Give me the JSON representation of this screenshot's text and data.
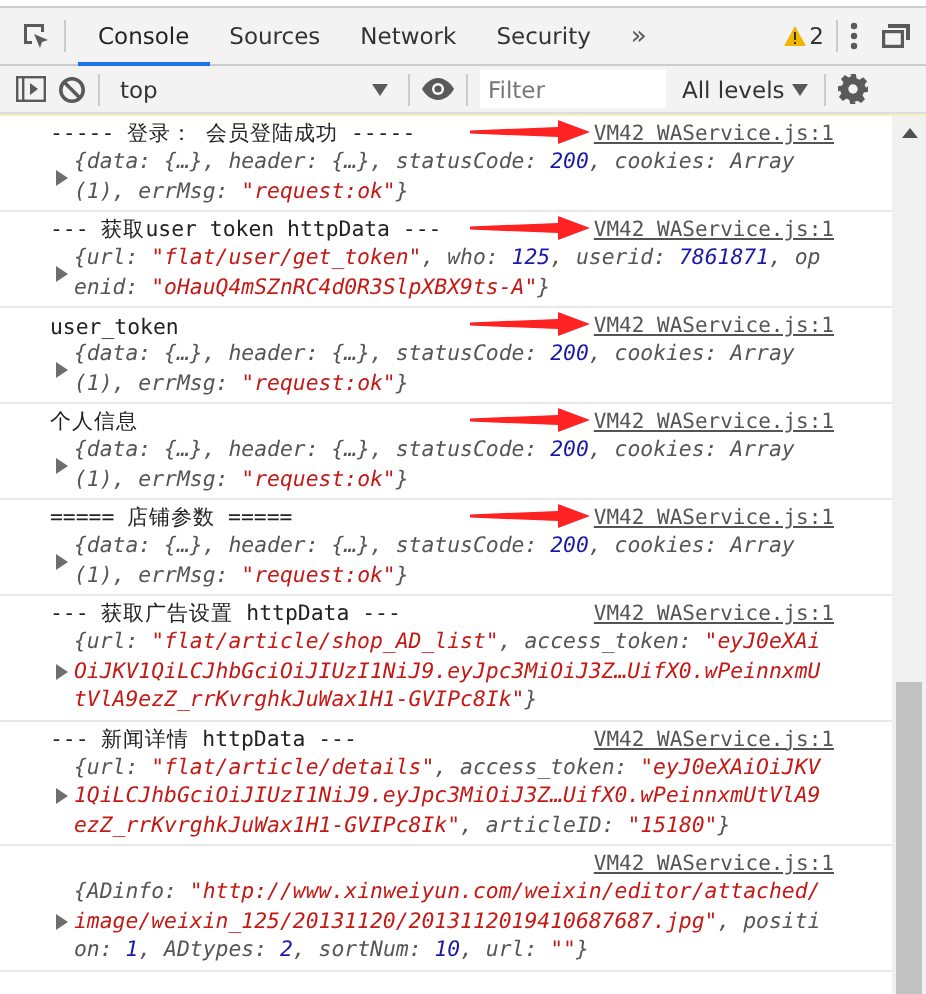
{
  "tabs": [
    {
      "label": "Console",
      "selected": true
    },
    {
      "label": "Sources",
      "selected": false
    },
    {
      "label": "Network",
      "selected": false
    },
    {
      "label": "Security",
      "selected": false
    }
  ],
  "more_tabs": "»",
  "warnings": "2",
  "toolbar": {
    "context": "top",
    "filter_placeholder": "Filter",
    "levels": "All levels"
  },
  "entries": [
    {
      "message": "----- 登录： 会员登陆成功 -----",
      "source": "VM42 WAService.js:1",
      "arrow": true,
      "object": [
        [
          {
            "kind": "text",
            "text": "{data: {…}, header: {…}, statusCode: "
          },
          {
            "kind": "number",
            "text": "200"
          },
          {
            "kind": "text",
            "text": ", cookies: Array"
          }
        ],
        [
          {
            "kind": "text",
            "text": "(1), errMsg: "
          },
          {
            "kind": "string",
            "text": "\"request:ok\""
          },
          {
            "kind": "text",
            "text": "}"
          }
        ]
      ]
    },
    {
      "message": "--- 获取user token httpData ---",
      "source": "VM42 WAService.js:1",
      "arrow": true,
      "object": [
        [
          {
            "kind": "text",
            "text": "{url: "
          },
          {
            "kind": "string",
            "text": "\"flat/user/get_token\""
          },
          {
            "kind": "text",
            "text": ", who: "
          },
          {
            "kind": "number",
            "text": "125"
          },
          {
            "kind": "text",
            "text": ", userid: "
          },
          {
            "kind": "number",
            "text": "7861871"
          },
          {
            "kind": "text",
            "text": ", op"
          }
        ],
        [
          {
            "kind": "text",
            "text": "enid: "
          },
          {
            "kind": "string",
            "text": "\"oHauQ4mSZnRC4d0R3SlpXBX9ts-A\""
          },
          {
            "kind": "text",
            "text": "}"
          }
        ]
      ]
    },
    {
      "message": "user_token",
      "source": "VM42 WAService.js:1",
      "arrow": true,
      "object": [
        [
          {
            "kind": "text",
            "text": "{data: {…}, header: {…}, statusCode: "
          },
          {
            "kind": "number",
            "text": "200"
          },
          {
            "kind": "text",
            "text": ", cookies: Array"
          }
        ],
        [
          {
            "kind": "text",
            "text": "(1), errMsg: "
          },
          {
            "kind": "string",
            "text": "\"request:ok\""
          },
          {
            "kind": "text",
            "text": "}"
          }
        ]
      ]
    },
    {
      "message": "个人信息",
      "source": "VM42 WAService.js:1",
      "arrow": true,
      "object": [
        [
          {
            "kind": "text",
            "text": "{data: {…}, header: {…}, statusCode: "
          },
          {
            "kind": "number",
            "text": "200"
          },
          {
            "kind": "text",
            "text": ", cookies: Array"
          }
        ],
        [
          {
            "kind": "text",
            "text": "(1), errMsg: "
          },
          {
            "kind": "string",
            "text": "\"request:ok\""
          },
          {
            "kind": "text",
            "text": "}"
          }
        ]
      ]
    },
    {
      "message": "===== 店铺参数 =====",
      "source": "VM42 WAService.js:1",
      "arrow": true,
      "object": [
        [
          {
            "kind": "text",
            "text": "{data: {…}, header: {…}, statusCode: "
          },
          {
            "kind": "number",
            "text": "200"
          },
          {
            "kind": "text",
            "text": ", cookies: Array"
          }
        ],
        [
          {
            "kind": "text",
            "text": "(1), errMsg: "
          },
          {
            "kind": "string",
            "text": "\"request:ok\""
          },
          {
            "kind": "text",
            "text": "}"
          }
        ]
      ]
    },
    {
      "message": "--- 获取广告设置 httpData ---",
      "source": "VM42 WAService.js:1",
      "arrow": false,
      "object": [
        [
          {
            "kind": "text",
            "text": "{url: "
          },
          {
            "kind": "string",
            "text": "\"flat/article/shop_AD_list\""
          },
          {
            "kind": "text",
            "text": ", access_token: "
          },
          {
            "kind": "string",
            "text": "\"eyJ0eXAi"
          }
        ],
        [
          {
            "kind": "string",
            "text": "OiJKV1QiLCJhbGciOiJIUzI1NiJ9.eyJpc3MiOiJ3Z…UifX0.wPeinnxmU"
          }
        ],
        [
          {
            "kind": "string",
            "text": "tVlA9ezZ_rrKvrghkJuWax1H1-GVIPc8Ik\""
          },
          {
            "kind": "text",
            "text": "}"
          }
        ]
      ]
    },
    {
      "message": "--- 新闻详情 httpData ---",
      "source": "VM42 WAService.js:1",
      "arrow": false,
      "object": [
        [
          {
            "kind": "text",
            "text": "{url: "
          },
          {
            "kind": "string",
            "text": "\"flat/article/details\""
          },
          {
            "kind": "text",
            "text": ", access_token: "
          },
          {
            "kind": "string",
            "text": "\"eyJ0eXAiOiJKV"
          }
        ],
        [
          {
            "kind": "string",
            "text": "1QiLCJhbGciOiJIUzI1NiJ9.eyJpc3MiOiJ3Z…UifX0.wPeinnxmUtVlA9"
          }
        ],
        [
          {
            "kind": "string",
            "text": "ezZ_rrKvrghkJuWax1H1-GVIPc8Ik\""
          },
          {
            "kind": "text",
            "text": ", articleID: "
          },
          {
            "kind": "string",
            "text": "\"15180\""
          },
          {
            "kind": "text",
            "text": "}"
          }
        ]
      ]
    },
    {
      "source": "VM42 WAService.js:1",
      "arrow": false,
      "object": [
        [
          {
            "kind": "text",
            "text": "{ADinfo: "
          },
          {
            "kind": "string",
            "text": "\"http://www.xinweiyun.com/weixin/editor/attached/"
          }
        ],
        [
          {
            "kind": "string",
            "text": "image/weixin_125/20131120/2013112019410687687.jpg\""
          },
          {
            "kind": "text",
            "text": ", positi"
          }
        ],
        [
          {
            "kind": "text",
            "text": "on: "
          },
          {
            "kind": "number",
            "text": "1"
          },
          {
            "kind": "text",
            "text": ", ADtypes: "
          },
          {
            "kind": "number",
            "text": "2"
          },
          {
            "kind": "text",
            "text": ", sortNum: "
          },
          {
            "kind": "number",
            "text": "10"
          },
          {
            "kind": "text",
            "text": ", url: "
          },
          {
            "kind": "string",
            "text": "\"\""
          },
          {
            "kind": "text",
            "text": "}"
          }
        ]
      ]
    }
  ]
}
